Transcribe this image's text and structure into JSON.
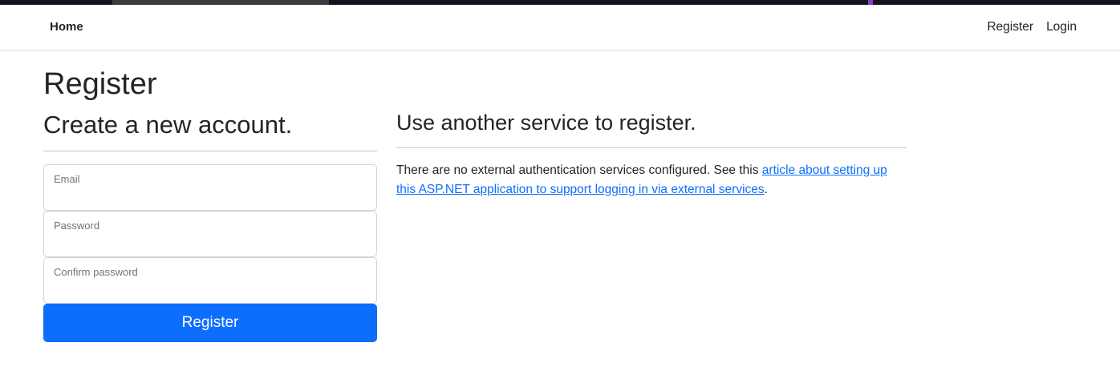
{
  "nav": {
    "brand": "Home",
    "links": [
      {
        "label": "Register"
      },
      {
        "label": "Login"
      }
    ]
  },
  "page": {
    "title": "Register"
  },
  "form": {
    "heading": "Create a new account.",
    "fields": {
      "email": {
        "label": "Email",
        "value": ""
      },
      "password": {
        "label": "Password",
        "value": ""
      },
      "confirm": {
        "label": "Confirm password",
        "value": ""
      }
    },
    "submit_label": "Register"
  },
  "external": {
    "heading": "Use another service to register.",
    "text_before": "There are no external authentication services configured. See this ",
    "link_text": "article about setting up this ASP.NET application to support logging in via external services",
    "text_after": "."
  },
  "colors": {
    "primary": "#0d6efd",
    "text": "#212529",
    "muted": "#6c757d"
  }
}
